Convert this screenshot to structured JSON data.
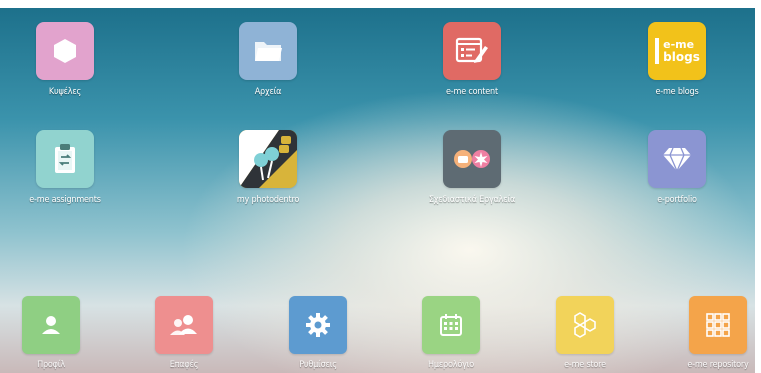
{
  "apps": [
    {
      "label": "Κυψέλες",
      "icon": "hexagon-icon",
      "color": "#e2a3cd"
    },
    {
      "label": "Αρχεία",
      "icon": "folder-icon",
      "color": "#8fb3d6"
    },
    {
      "label": "e-me content",
      "icon": "content-editor-icon",
      "color": "#e06a64"
    },
    {
      "label": "e-me blogs",
      "icon": "blogs-logo-icon",
      "color": "#f2c21a",
      "badge_line1": "e-me",
      "badge_line2": "blogs"
    },
    {
      "label": "e-me assignments",
      "icon": "clipboard-icon",
      "color": "#91d3cf"
    },
    {
      "label": "my photodentro",
      "icon": "photodentro-icon",
      "color": "#d8b43a"
    },
    {
      "label": "Σχεδιαστικά Εργαλεία",
      "icon": "design-tools-icon",
      "color": "#5e6b73"
    },
    {
      "label": "e-portfolio",
      "icon": "diamond-icon",
      "color": "#8b95d2"
    }
  ],
  "dock": [
    {
      "label": "Προφίλ",
      "icon": "user-icon",
      "color": "#8fcf83"
    },
    {
      "label": "Επαφές",
      "icon": "contacts-icon",
      "color": "#ee8f8f"
    },
    {
      "label": "Ρυθμίσεις",
      "icon": "gear-icon",
      "color": "#5d9bd0"
    },
    {
      "label": "Ημερολόγιο",
      "icon": "calendar-icon",
      "color": "#9ad483"
    },
    {
      "label": "e-me store",
      "icon": "store-hexagons-icon",
      "color": "#f2d35a"
    },
    {
      "label": "e-me repository",
      "icon": "repository-grid-icon",
      "color": "#f4a44a"
    }
  ]
}
